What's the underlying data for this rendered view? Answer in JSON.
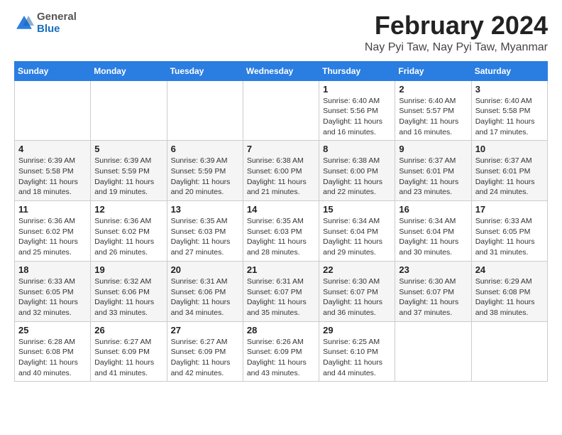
{
  "header": {
    "month_title": "February 2024",
    "location": "Nay Pyi Taw, Nay Pyi Taw, Myanmar",
    "logo_general": "General",
    "logo_blue": "Blue"
  },
  "columns": [
    "Sunday",
    "Monday",
    "Tuesday",
    "Wednesday",
    "Thursday",
    "Friday",
    "Saturday"
  ],
  "weeks": [
    [
      {
        "day": "",
        "sunrise": "",
        "sunset": "",
        "daylight": ""
      },
      {
        "day": "",
        "sunrise": "",
        "sunset": "",
        "daylight": ""
      },
      {
        "day": "",
        "sunrise": "",
        "sunset": "",
        "daylight": ""
      },
      {
        "day": "",
        "sunrise": "",
        "sunset": "",
        "daylight": ""
      },
      {
        "day": "1",
        "sunrise": "Sunrise: 6:40 AM",
        "sunset": "Sunset: 5:56 PM",
        "daylight": "Daylight: 11 hours and 16 minutes."
      },
      {
        "day": "2",
        "sunrise": "Sunrise: 6:40 AM",
        "sunset": "Sunset: 5:57 PM",
        "daylight": "Daylight: 11 hours and 16 minutes."
      },
      {
        "day": "3",
        "sunrise": "Sunrise: 6:40 AM",
        "sunset": "Sunset: 5:58 PM",
        "daylight": "Daylight: 11 hours and 17 minutes."
      }
    ],
    [
      {
        "day": "4",
        "sunrise": "Sunrise: 6:39 AM",
        "sunset": "Sunset: 5:58 PM",
        "daylight": "Daylight: 11 hours and 18 minutes."
      },
      {
        "day": "5",
        "sunrise": "Sunrise: 6:39 AM",
        "sunset": "Sunset: 5:59 PM",
        "daylight": "Daylight: 11 hours and 19 minutes."
      },
      {
        "day": "6",
        "sunrise": "Sunrise: 6:39 AM",
        "sunset": "Sunset: 5:59 PM",
        "daylight": "Daylight: 11 hours and 20 minutes."
      },
      {
        "day": "7",
        "sunrise": "Sunrise: 6:38 AM",
        "sunset": "Sunset: 6:00 PM",
        "daylight": "Daylight: 11 hours and 21 minutes."
      },
      {
        "day": "8",
        "sunrise": "Sunrise: 6:38 AM",
        "sunset": "Sunset: 6:00 PM",
        "daylight": "Daylight: 11 hours and 22 minutes."
      },
      {
        "day": "9",
        "sunrise": "Sunrise: 6:37 AM",
        "sunset": "Sunset: 6:01 PM",
        "daylight": "Daylight: 11 hours and 23 minutes."
      },
      {
        "day": "10",
        "sunrise": "Sunrise: 6:37 AM",
        "sunset": "Sunset: 6:01 PM",
        "daylight": "Daylight: 11 hours and 24 minutes."
      }
    ],
    [
      {
        "day": "11",
        "sunrise": "Sunrise: 6:36 AM",
        "sunset": "Sunset: 6:02 PM",
        "daylight": "Daylight: 11 hours and 25 minutes."
      },
      {
        "day": "12",
        "sunrise": "Sunrise: 6:36 AM",
        "sunset": "Sunset: 6:02 PM",
        "daylight": "Daylight: 11 hours and 26 minutes."
      },
      {
        "day": "13",
        "sunrise": "Sunrise: 6:35 AM",
        "sunset": "Sunset: 6:03 PM",
        "daylight": "Daylight: 11 hours and 27 minutes."
      },
      {
        "day": "14",
        "sunrise": "Sunrise: 6:35 AM",
        "sunset": "Sunset: 6:03 PM",
        "daylight": "Daylight: 11 hours and 28 minutes."
      },
      {
        "day": "15",
        "sunrise": "Sunrise: 6:34 AM",
        "sunset": "Sunset: 6:04 PM",
        "daylight": "Daylight: 11 hours and 29 minutes."
      },
      {
        "day": "16",
        "sunrise": "Sunrise: 6:34 AM",
        "sunset": "Sunset: 6:04 PM",
        "daylight": "Daylight: 11 hours and 30 minutes."
      },
      {
        "day": "17",
        "sunrise": "Sunrise: 6:33 AM",
        "sunset": "Sunset: 6:05 PM",
        "daylight": "Daylight: 11 hours and 31 minutes."
      }
    ],
    [
      {
        "day": "18",
        "sunrise": "Sunrise: 6:33 AM",
        "sunset": "Sunset: 6:05 PM",
        "daylight": "Daylight: 11 hours and 32 minutes."
      },
      {
        "day": "19",
        "sunrise": "Sunrise: 6:32 AM",
        "sunset": "Sunset: 6:06 PM",
        "daylight": "Daylight: 11 hours and 33 minutes."
      },
      {
        "day": "20",
        "sunrise": "Sunrise: 6:31 AM",
        "sunset": "Sunset: 6:06 PM",
        "daylight": "Daylight: 11 hours and 34 minutes."
      },
      {
        "day": "21",
        "sunrise": "Sunrise: 6:31 AM",
        "sunset": "Sunset: 6:07 PM",
        "daylight": "Daylight: 11 hours and 35 minutes."
      },
      {
        "day": "22",
        "sunrise": "Sunrise: 6:30 AM",
        "sunset": "Sunset: 6:07 PM",
        "daylight": "Daylight: 11 hours and 36 minutes."
      },
      {
        "day": "23",
        "sunrise": "Sunrise: 6:30 AM",
        "sunset": "Sunset: 6:07 PM",
        "daylight": "Daylight: 11 hours and 37 minutes."
      },
      {
        "day": "24",
        "sunrise": "Sunrise: 6:29 AM",
        "sunset": "Sunset: 6:08 PM",
        "daylight": "Daylight: 11 hours and 38 minutes."
      }
    ],
    [
      {
        "day": "25",
        "sunrise": "Sunrise: 6:28 AM",
        "sunset": "Sunset: 6:08 PM",
        "daylight": "Daylight: 11 hours and 40 minutes."
      },
      {
        "day": "26",
        "sunrise": "Sunrise: 6:27 AM",
        "sunset": "Sunset: 6:09 PM",
        "daylight": "Daylight: 11 hours and 41 minutes."
      },
      {
        "day": "27",
        "sunrise": "Sunrise: 6:27 AM",
        "sunset": "Sunset: 6:09 PM",
        "daylight": "Daylight: 11 hours and 42 minutes."
      },
      {
        "day": "28",
        "sunrise": "Sunrise: 6:26 AM",
        "sunset": "Sunset: 6:09 PM",
        "daylight": "Daylight: 11 hours and 43 minutes."
      },
      {
        "day": "29",
        "sunrise": "Sunrise: 6:25 AM",
        "sunset": "Sunset: 6:10 PM",
        "daylight": "Daylight: 11 hours and 44 minutes."
      },
      {
        "day": "",
        "sunrise": "",
        "sunset": "",
        "daylight": ""
      },
      {
        "day": "",
        "sunrise": "",
        "sunset": "",
        "daylight": ""
      }
    ]
  ]
}
